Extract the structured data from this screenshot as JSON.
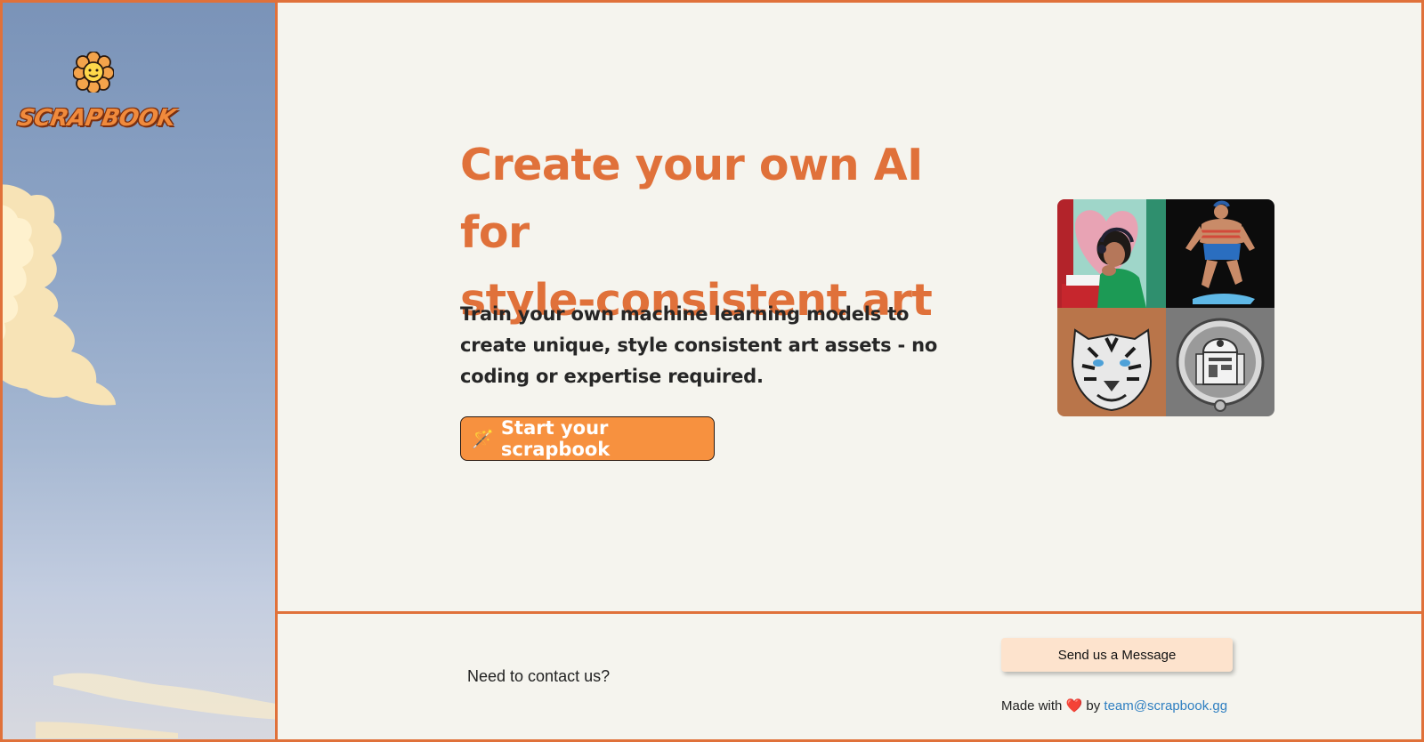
{
  "brand": {
    "name": "SCRAPBOOK",
    "accent_color": "#e0713a",
    "cta_color": "#f7913f"
  },
  "hero": {
    "title_line1": "Create your own AI for",
    "title_line2": "style-consistent art",
    "subtitle": "Train your own machine learning models to create unique, style consistent art assets - no coding or expertise required.",
    "cta_icon": "🪄",
    "cta_label": "Start your scrapbook"
  },
  "gallery": {
    "tiles": [
      "paper-art-girl-with-headphones",
      "paper-art-muscular-man",
      "paper-art-tiger",
      "paper-art-robot-medallion"
    ]
  },
  "footer": {
    "contact_prompt": "Need to contact us?",
    "message_button": "Send us a Message",
    "made_with_prefix": "Made with",
    "heart": "❤️",
    "made_with_by": "by",
    "email": "team@scrapbook.gg"
  }
}
